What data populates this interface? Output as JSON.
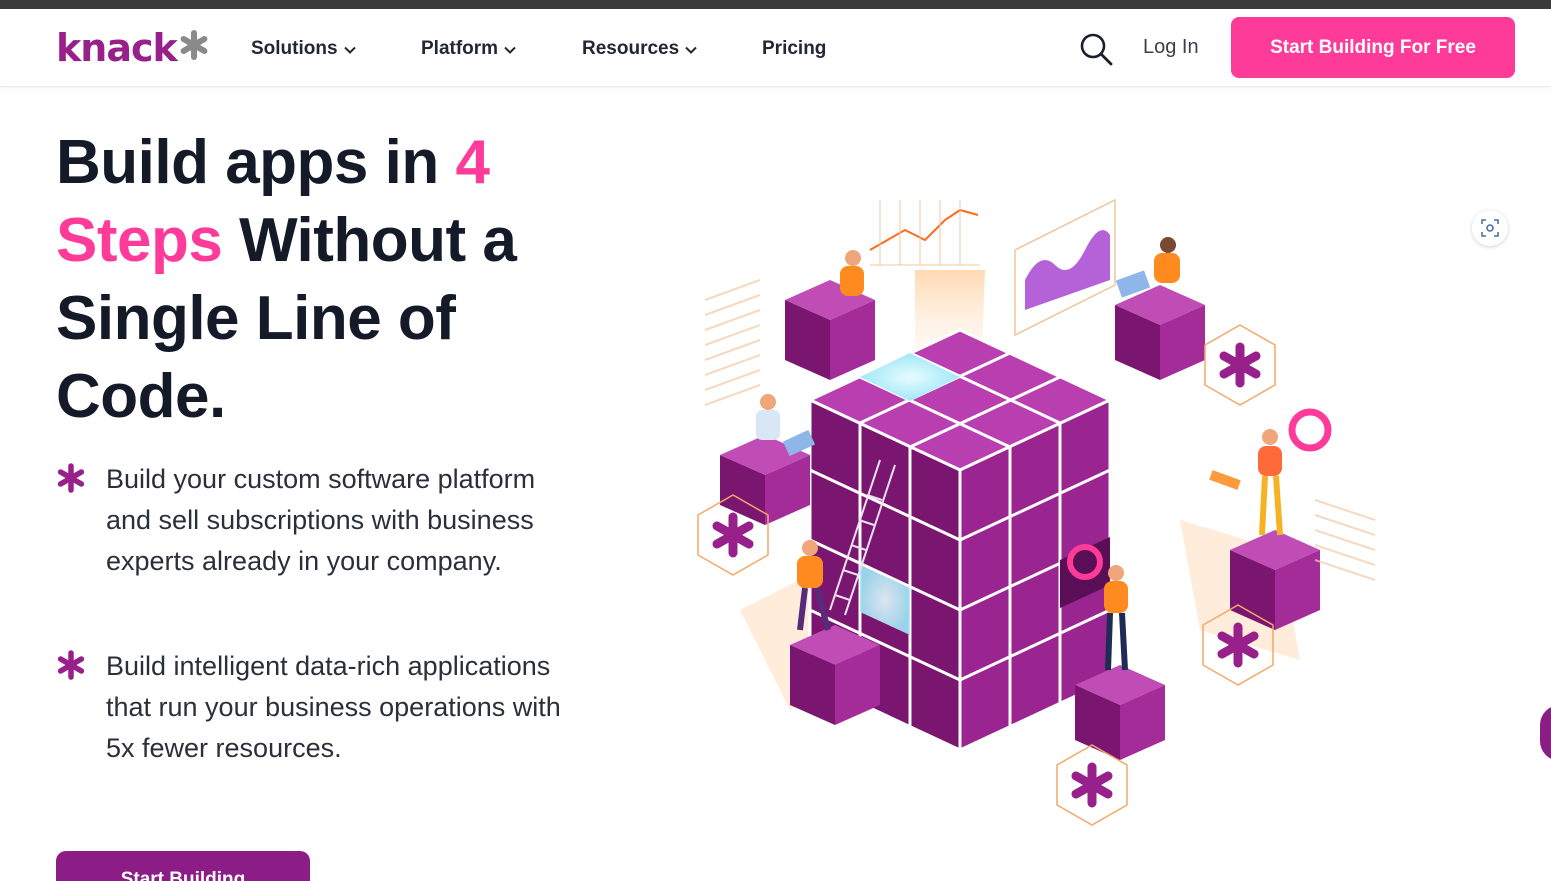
{
  "nav": {
    "logo_text": "knack",
    "items": [
      {
        "label": "Solutions",
        "has_dropdown": true
      },
      {
        "label": "Platform",
        "has_dropdown": true
      },
      {
        "label": "Resources",
        "has_dropdown": true
      },
      {
        "label": "Pricing",
        "has_dropdown": false
      }
    ],
    "login_label": "Log In",
    "cta_label": "Start Building For Free",
    "search_icon": "search-icon"
  },
  "hero": {
    "title_part1": "Build apps in ",
    "title_highlight1": "4",
    "title_highlight2": "Steps",
    "title_part2": " Without a Single Line of Code.",
    "bullets": [
      "Build your custom software platform and sell subscriptions with business experts already in your company.",
      "Build intelligent data-rich applications that run your business operations with 5x fewer resources."
    ],
    "bullet_icon": "asterisk-icon",
    "cta_label": "Start Building"
  },
  "colors": {
    "brand_purple": "#98208a",
    "accent_pink": "#ff3b9a",
    "cta_purple": "#8c1c86",
    "heading": "#141a28"
  }
}
